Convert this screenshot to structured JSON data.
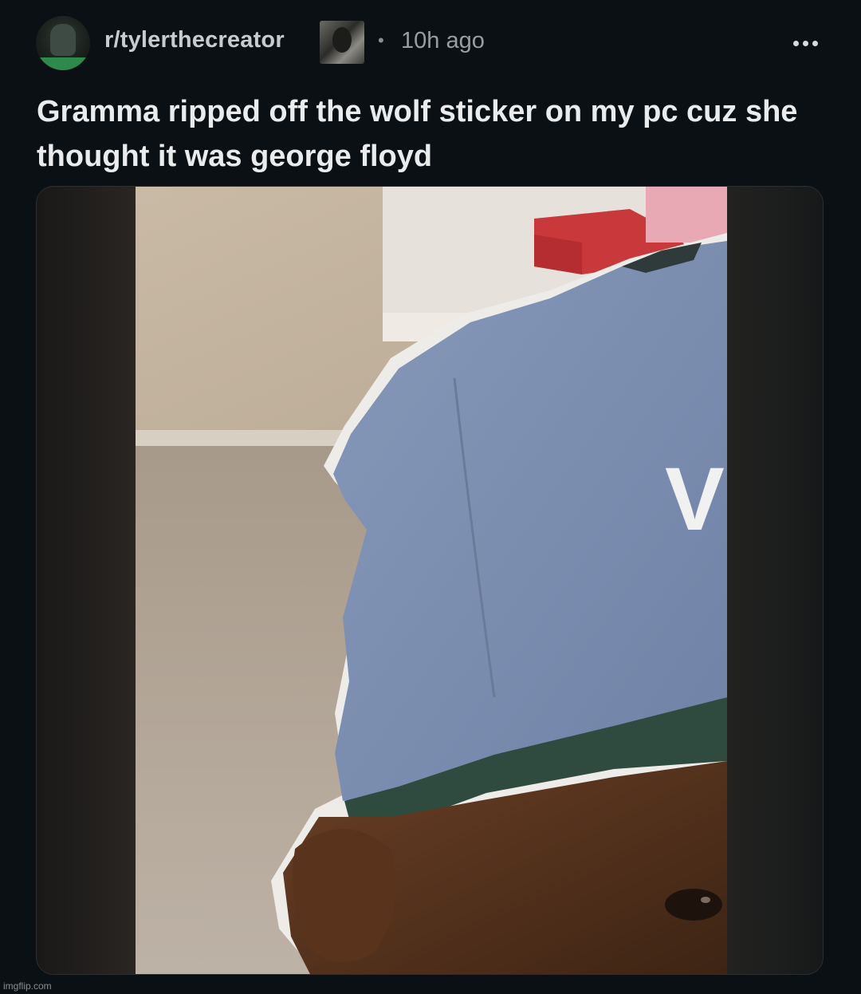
{
  "header": {
    "subreddit": "r/tylerthecreator",
    "separator": "•",
    "time_ago": "10h ago",
    "more_icon": "more-horizontal-icon"
  },
  "post": {
    "title": "Gramma ripped off the wolf sticker on my pc cuz she thought it was george floyd"
  },
  "photo": {
    "cap_letter": "V"
  },
  "footer": {
    "watermark": "imgflip.com"
  },
  "colors": {
    "background": "#0b1014",
    "title": "#e9ebec",
    "meta": "#9a9ea1",
    "cap_blue": "#7d90b4"
  }
}
